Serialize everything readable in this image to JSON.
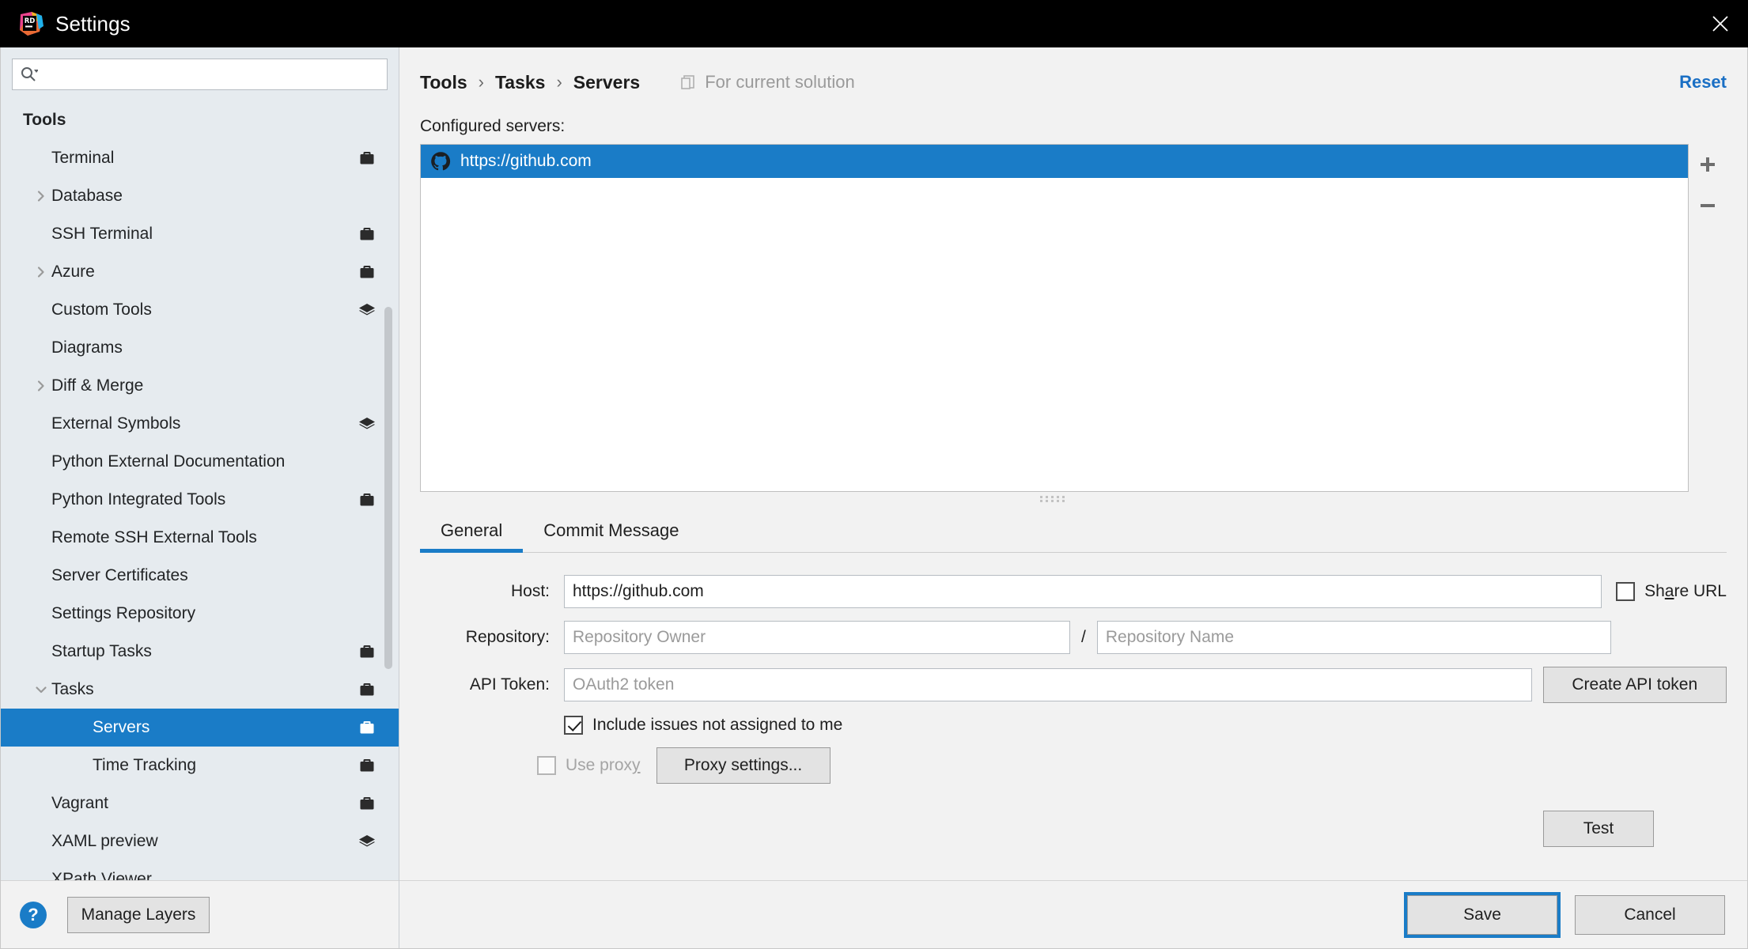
{
  "window": {
    "title": "Settings",
    "app_icon": "rider-icon",
    "close_icon": "close-icon"
  },
  "sidebar": {
    "search": {
      "placeholder": "",
      "value": "",
      "icon": "search-icon",
      "dropdown_icon": "chevron-down-icon"
    },
    "items": [
      {
        "label": "Tools",
        "level": 0,
        "arrow": "none",
        "badge": "none",
        "selected": false,
        "bold": true
      },
      {
        "label": "Terminal",
        "level": 1,
        "arrow": "none",
        "badge": "briefcase",
        "selected": false,
        "bold": false
      },
      {
        "label": "Database",
        "level": 1,
        "arrow": "right",
        "badge": "none",
        "selected": false,
        "bold": false
      },
      {
        "label": "SSH Terminal",
        "level": 1,
        "arrow": "none",
        "badge": "briefcase",
        "selected": false,
        "bold": false
      },
      {
        "label": "Azure",
        "level": 1,
        "arrow": "right",
        "badge": "briefcase",
        "selected": false,
        "bold": false
      },
      {
        "label": "Custom Tools",
        "level": 1,
        "arrow": "none",
        "badge": "layers",
        "selected": false,
        "bold": false
      },
      {
        "label": "Diagrams",
        "level": 1,
        "arrow": "none",
        "badge": "none",
        "selected": false,
        "bold": false
      },
      {
        "label": "Diff & Merge",
        "level": 1,
        "arrow": "right",
        "badge": "none",
        "selected": false,
        "bold": false
      },
      {
        "label": "External Symbols",
        "level": 1,
        "arrow": "none",
        "badge": "layers",
        "selected": false,
        "bold": false
      },
      {
        "label": "Python External Documentation",
        "level": 1,
        "arrow": "none",
        "badge": "none",
        "selected": false,
        "bold": false
      },
      {
        "label": "Python Integrated Tools",
        "level": 1,
        "arrow": "none",
        "badge": "briefcase",
        "selected": false,
        "bold": false
      },
      {
        "label": "Remote SSH External Tools",
        "level": 1,
        "arrow": "none",
        "badge": "none",
        "selected": false,
        "bold": false
      },
      {
        "label": "Server Certificates",
        "level": 1,
        "arrow": "none",
        "badge": "none",
        "selected": false,
        "bold": false
      },
      {
        "label": "Settings Repository",
        "level": 1,
        "arrow": "none",
        "badge": "none",
        "selected": false,
        "bold": false
      },
      {
        "label": "Startup Tasks",
        "level": 1,
        "arrow": "none",
        "badge": "briefcase",
        "selected": false,
        "bold": false
      },
      {
        "label": "Tasks",
        "level": 1,
        "arrow": "down",
        "badge": "briefcase",
        "selected": false,
        "bold": false
      },
      {
        "label": "Servers",
        "level": 2,
        "arrow": "none",
        "badge": "briefcase",
        "selected": true,
        "bold": false
      },
      {
        "label": "Time Tracking",
        "level": 2,
        "arrow": "none",
        "badge": "briefcase",
        "selected": false,
        "bold": false
      },
      {
        "label": "Vagrant",
        "level": 1,
        "arrow": "none",
        "badge": "briefcase",
        "selected": false,
        "bold": false
      },
      {
        "label": "XAML preview",
        "level": 1,
        "arrow": "none",
        "badge": "layers",
        "selected": false,
        "bold": false
      },
      {
        "label": "XPath Viewer",
        "level": 1,
        "arrow": "none",
        "badge": "none",
        "selected": false,
        "bold": false
      }
    ],
    "footer": {
      "help_label": "?",
      "manage_layers_label": "Manage Layers"
    }
  },
  "header": {
    "breadcrumb": [
      "Tools",
      "Tasks",
      "Servers"
    ],
    "separator": "›",
    "for_solution_label": "For current solution",
    "for_solution_icon": "copy-icon",
    "reset_label": "Reset"
  },
  "main": {
    "configured_servers_label": "Configured servers:",
    "servers": [
      {
        "name": "https://github.com",
        "icon": "github-icon",
        "selected": true
      }
    ],
    "list_toolbar": [
      {
        "name": "add-server-button",
        "icon": "plus-icon"
      },
      {
        "name": "remove-server-button",
        "icon": "minus-icon"
      }
    ],
    "tabs": [
      {
        "label": "General",
        "active": true
      },
      {
        "label": "Commit Message",
        "active": false
      }
    ],
    "form": {
      "host_label": "Host:",
      "host_value": "https://github.com",
      "host_placeholder": "",
      "share_url_label_a": "Sh",
      "share_url_label_mnemonic": "a",
      "share_url_label_b": "re URL",
      "share_url_checked": false,
      "repository_label": "Repository:",
      "repository_owner_value": "",
      "repository_owner_placeholder": "Repository Owner",
      "repository_separator": "/",
      "repository_name_value": "",
      "repository_name_placeholder": "Repository Name",
      "api_token_label": "API Token:",
      "api_token_value": "",
      "api_token_placeholder": "OAuth2 token",
      "create_api_token_label": "Create API token",
      "include_issues_label": "Include issues not assigned to me",
      "include_issues_checked": true,
      "use_proxy_label_a": "Use prox",
      "use_proxy_label_mnemonic": "y",
      "use_proxy_checked": false,
      "use_proxy_disabled": true,
      "proxy_settings_label": "Proxy settings...",
      "test_label": "Test"
    }
  },
  "footer": {
    "save_label": "Save",
    "cancel_label": "Cancel"
  },
  "colors": {
    "accent": "#1a7cc7",
    "link": "#1a6fc4",
    "sidebar_bg": "#e6ebef",
    "panel_bg": "#f2f2f2",
    "titlebar_bg": "#000000"
  }
}
